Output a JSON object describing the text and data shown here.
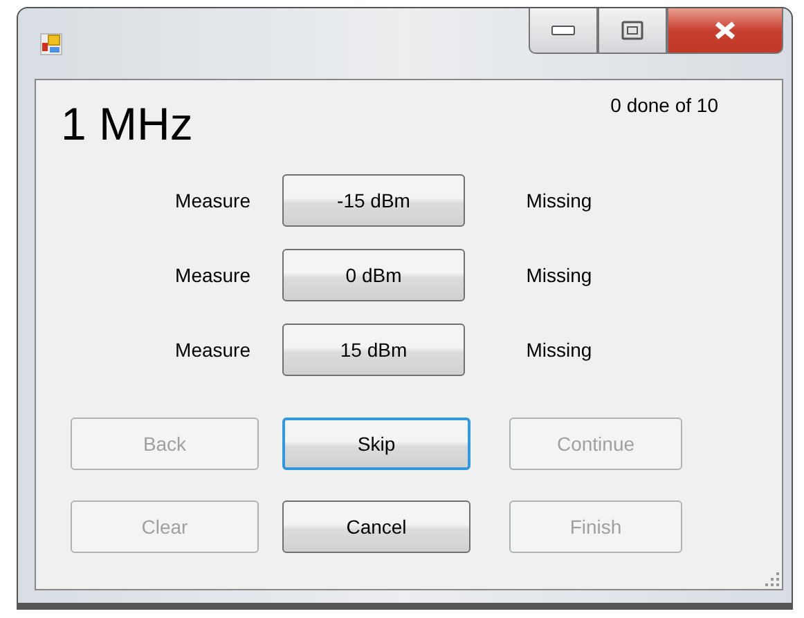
{
  "frequency": "1 MHz",
  "progress": "0 done of 10",
  "measurements": [
    {
      "label": "Measure",
      "button": "-15 dBm",
      "status": "Missing"
    },
    {
      "label": "Measure",
      "button": "0 dBm",
      "status": "Missing"
    },
    {
      "label": "Measure",
      "button": "15 dBm",
      "status": "Missing"
    }
  ],
  "buttons": [
    {
      "label": "Back",
      "disabled": true,
      "focused": false
    },
    {
      "label": "Skip",
      "disabled": false,
      "focused": true
    },
    {
      "label": "Continue",
      "disabled": true,
      "focused": false
    },
    {
      "label": "Clear",
      "disabled": true,
      "focused": false
    },
    {
      "label": "Cancel",
      "disabled": false,
      "focused": false
    },
    {
      "label": "Finish",
      "disabled": true,
      "focused": false
    }
  ]
}
